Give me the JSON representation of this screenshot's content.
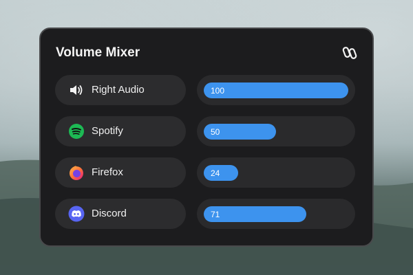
{
  "mixer": {
    "title": "Volume Mixer",
    "link_icon": "link-icon"
  },
  "apps": [
    {
      "label": "Right Audio",
      "icon": "speaker-icon",
      "volume": 100,
      "volume_text": "100"
    },
    {
      "label": "Spotify",
      "icon": "spotify-icon",
      "volume": 50,
      "volume_text": "50",
      "color": "#1db954"
    },
    {
      "label": "Firefox",
      "icon": "firefox-icon",
      "volume": 24,
      "volume_text": "24",
      "color": "#ff7139"
    },
    {
      "label": "Discord",
      "icon": "discord-icon",
      "volume": 71,
      "volume_text": "71",
      "color": "#5865f2"
    }
  ],
  "colors": {
    "accent": "#3d93ee",
    "panel": "#1c1c1e",
    "pill": "#2c2c2e"
  }
}
